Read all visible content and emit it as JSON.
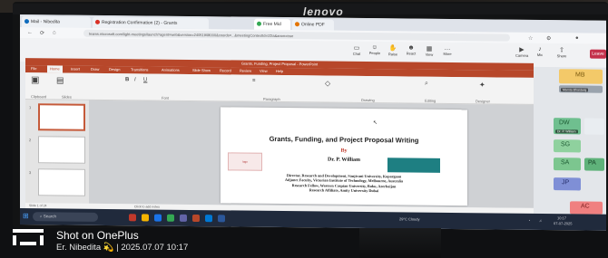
{
  "monitor": {
    "brand": "lenovo"
  },
  "browser": {
    "tabs": [
      {
        "label": "Mail - Nibedita",
        "color": "#0f6cbd"
      },
      {
        "label": "Registration Confirmation (2) - Grants",
        "color": "#d93025"
      },
      {
        "label": "Free Mid",
        "color": "#34a853"
      },
      {
        "label": "Online PDF",
        "color": "#e37400"
      }
    ],
    "url": "teams.microsoft.com/light-meetings/launch?agent=web&version=24051908000&coords=...&meetingContextId=1f2a&anon=true"
  },
  "meeting_toolbar": {
    "items": [
      {
        "label": "Chat",
        "icon": "chat-icon"
      },
      {
        "label": "People",
        "icon": "people-icon"
      },
      {
        "label": "Raise",
        "icon": "hand-icon"
      },
      {
        "label": "React",
        "icon": "react-icon"
      },
      {
        "label": "View",
        "icon": "view-icon"
      },
      {
        "label": "More",
        "icon": "more-icon"
      },
      {
        "label": "Camera",
        "icon": "camera-icon"
      },
      {
        "label": "Mic",
        "icon": "mic-icon"
      },
      {
        "label": "Share",
        "icon": "share-icon"
      }
    ],
    "leave_label": "Leave"
  },
  "powerpoint": {
    "title": "Grants, Funding, Project Proposal - PowerPoint",
    "tabs": [
      "File",
      "Home",
      "Insert",
      "Draw",
      "Design",
      "Transitions",
      "Animations",
      "Slide Show",
      "Record",
      "Review",
      "View",
      "Help"
    ],
    "active_tab": "Home",
    "ribbon_groups": [
      "Clipboard",
      "Slides",
      "Font",
      "Paragraph",
      "Drawing",
      "Editing",
      "Designer"
    ],
    "slide_numbers": [
      "1",
      "2",
      "3"
    ],
    "status_left": "Slide 1 of 24",
    "notes_hint": "Click to add notes"
  },
  "slide": {
    "title": "Grants, Funding, and Project Proposal Writing",
    "by": "By",
    "presenter": "Dr. P. William",
    "left_logo_text": "logo",
    "affiliation_lines": [
      "Director, Research and Development, Sanjivani University, Kopargaon",
      "Adjunct Faculty, Victorian Institute of Technology, Melbourne, Australia",
      "Research Fellow, Western Caspian University, Baku, Azerbaijan",
      "Research Affiliate, Amity University Dubai"
    ]
  },
  "participants": [
    {
      "initials": "MB",
      "name": "Mamta Bhardwaj",
      "color": "#f3c969",
      "text": "#7a5a10"
    },
    {
      "initials": "DW",
      "name": "Dr. P. William",
      "color": "#6fbf8f",
      "text": "#1d5a33"
    },
    {
      "initials": "SG",
      "name": "S G",
      "color": "#8fd19e",
      "text": "#1d5a33"
    },
    {
      "initials": "SA",
      "name": "S A",
      "color": "#7cc68f",
      "text": "#1d5a33"
    },
    {
      "initials": "PA",
      "name": "P A",
      "color": "#5fb27a",
      "text": "#123a22"
    },
    {
      "initials": "JP",
      "name": "J P",
      "color": "#7f8fd6",
      "text": "#222a66"
    },
    {
      "initials": "AC",
      "name": "A C",
      "color": "#f08080",
      "text": "#7a1e1e"
    }
  ],
  "taskbar": {
    "search_placeholder": "Search",
    "weather": "29°C Cloudy",
    "time": "10:17",
    "date": "07-07-2025"
  },
  "watermark": {
    "line1": "Shot on OnePlus",
    "line2": "Er. Nibedita 💫 | 2025.07.07 10:17"
  }
}
